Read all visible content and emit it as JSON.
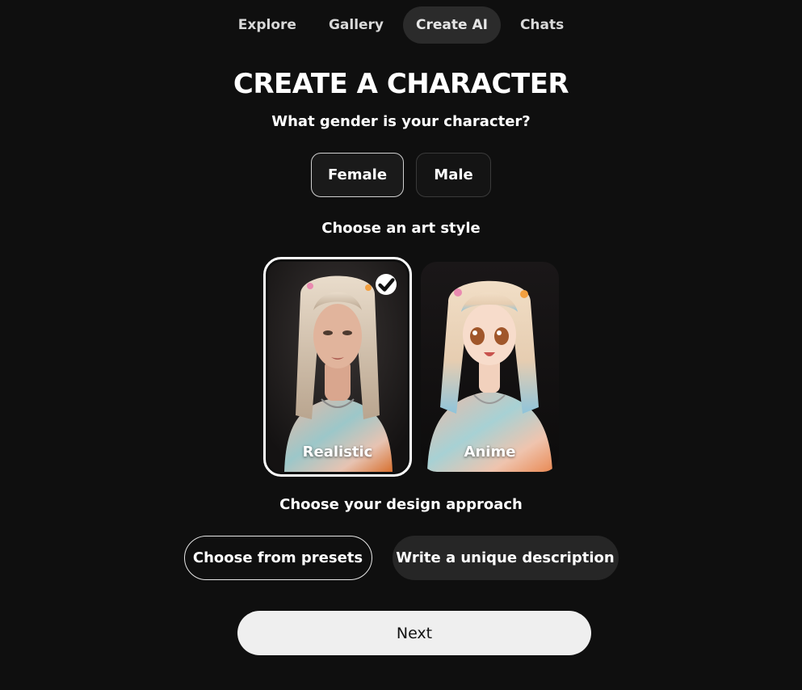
{
  "nav": {
    "tabs": [
      {
        "label": "Explore",
        "active": false
      },
      {
        "label": "Gallery",
        "active": false
      },
      {
        "label": "Create AI",
        "active": true
      },
      {
        "label": "Chats",
        "active": false
      }
    ]
  },
  "title": "CREATE A CHARACTER",
  "gender": {
    "question": "What gender is your character?",
    "options": [
      {
        "label": "Female",
        "selected": true
      },
      {
        "label": "Male",
        "selected": false
      }
    ]
  },
  "art_style": {
    "question": "Choose an art style",
    "options": [
      {
        "label": "Realistic",
        "selected": true,
        "icon": "check-icon"
      },
      {
        "label": "Anime",
        "selected": false
      }
    ]
  },
  "design": {
    "question": "Choose your design approach",
    "options": [
      {
        "label": "Choose from presets"
      },
      {
        "label": "Write a unique description"
      }
    ]
  },
  "next_label": "Next",
  "colors": {
    "background": "#0f0f0f",
    "active_tab": "#2b2b2b",
    "button_light": "#efefef",
    "button_dark": "#262626"
  }
}
